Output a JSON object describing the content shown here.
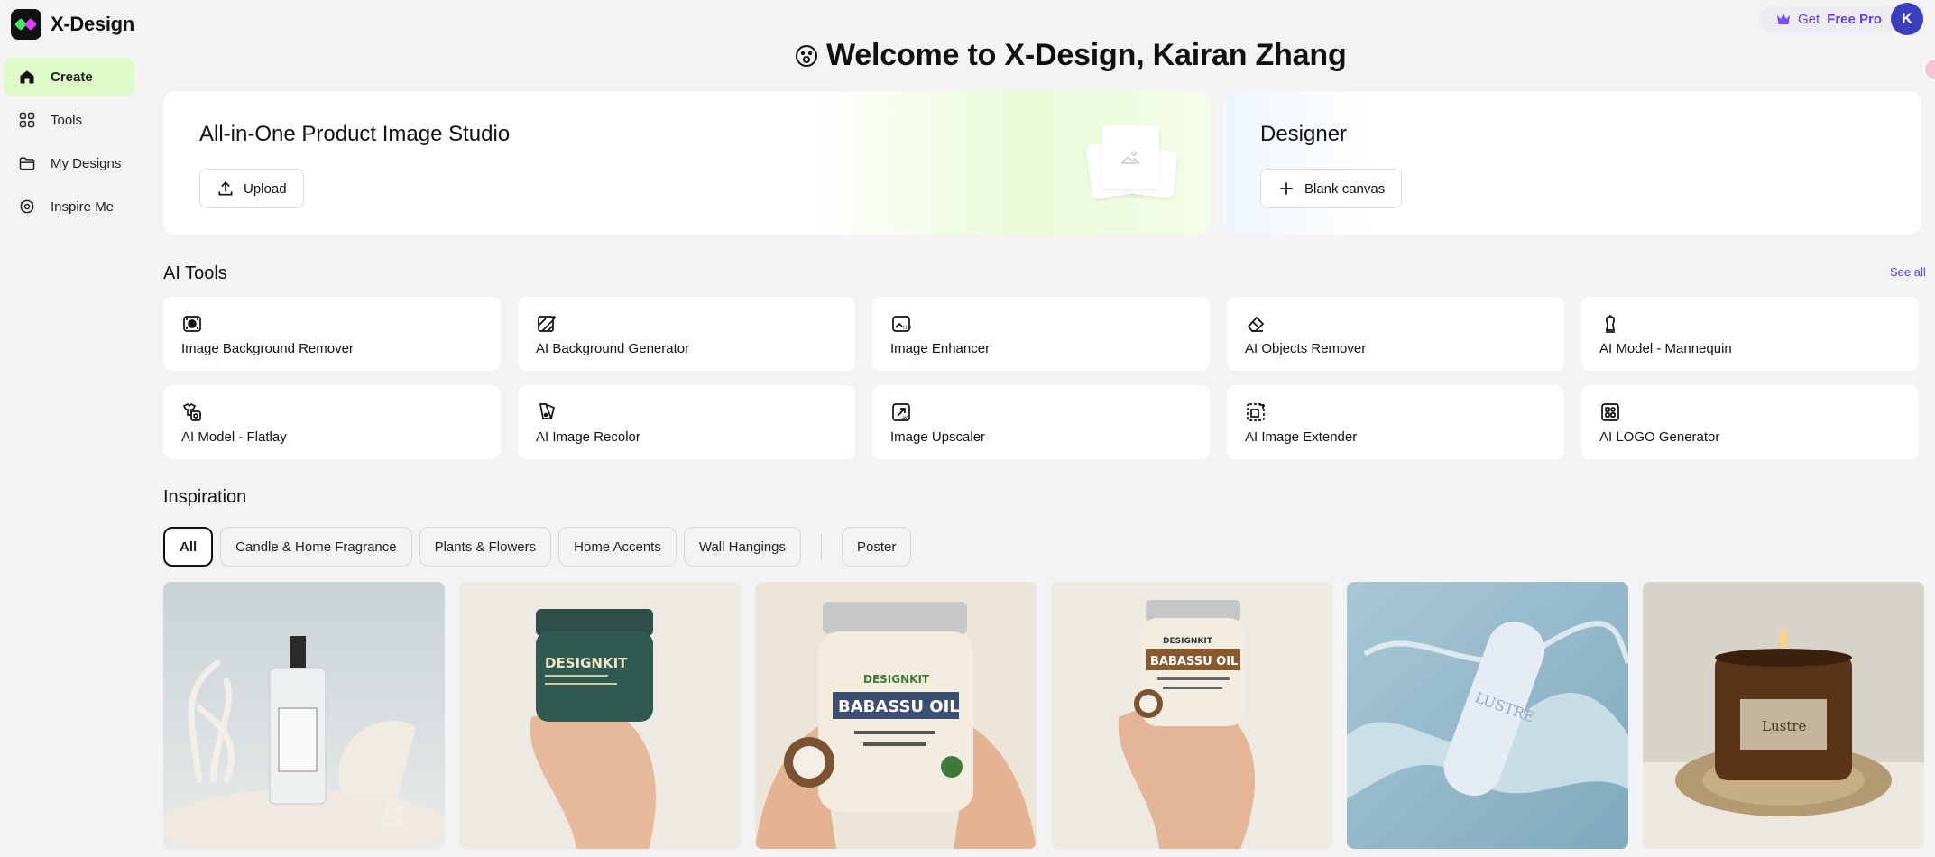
{
  "app": {
    "name": "X-Design"
  },
  "sidebar": {
    "items": [
      {
        "label": "Create",
        "icon": "home-icon",
        "active": true
      },
      {
        "label": "Tools",
        "icon": "grid-icon"
      },
      {
        "label": "My Designs",
        "icon": "folder-icon"
      },
      {
        "label": "Inspire Me",
        "icon": "inspire-icon"
      }
    ]
  },
  "topbar": {
    "pro_prefix": "Get ",
    "pro_highlight": "Free Pro",
    "avatar_initial": "K",
    "accent": "#6a3df2"
  },
  "welcome": {
    "title": "Welcome to X-Design, Kairan Zhang"
  },
  "hero": {
    "studio": {
      "title": "All-in-One Product Image Studio",
      "button": "Upload"
    },
    "designer": {
      "title": "Designer",
      "button": "Blank canvas"
    }
  },
  "ai_tools": {
    "heading": "AI Tools",
    "see_all": "See all",
    "items": [
      {
        "label": "Image Background Remover",
        "icon": "bg-remover-icon"
      },
      {
        "label": "AI Background Generator",
        "icon": "bg-generator-icon"
      },
      {
        "label": "Image Enhancer",
        "icon": "enhancer-icon"
      },
      {
        "label": "AI Objects Remover",
        "icon": "eraser-icon"
      },
      {
        "label": "AI Model - Mannequin",
        "icon": "mannequin-icon"
      },
      {
        "label": "AI Model - Flatlay",
        "icon": "flatlay-icon"
      },
      {
        "label": "AI Image Recolor",
        "icon": "recolor-icon"
      },
      {
        "label": "Image Upscaler",
        "icon": "upscaler-icon"
      },
      {
        "label": "AI Image Extender",
        "icon": "extender-icon"
      },
      {
        "label": "AI LOGO Generator",
        "icon": "logo-generator-icon"
      }
    ]
  },
  "inspiration": {
    "heading": "Inspiration",
    "filters": [
      "All",
      "Candle & Home Fragrance",
      "Plants & Flowers",
      "Home Accents",
      "Wall Hangings"
    ],
    "extra_filter": "Poster",
    "active_filter": "All",
    "images": [
      {
        "alt": "perfume-bottle-with-coral-and-shells"
      },
      {
        "alt": "hand-holding-designkit-jar",
        "label_brand": "DESIGNKIT"
      },
      {
        "alt": "hand-holding-babassu-oil-jar",
        "label_brand": "DESIGNKIT",
        "label_product": "BABASSU OIL"
      },
      {
        "alt": "hand-holding-small-babassu-oil-jar",
        "label_brand": "DESIGNKIT",
        "label_product": "BABASSU OIL"
      },
      {
        "alt": "lustre-bottle-in-water",
        "label_brand": "LUSTRE"
      },
      {
        "alt": "lustre-candle-on-woven-mat",
        "label_brand": "Lustre"
      }
    ]
  }
}
